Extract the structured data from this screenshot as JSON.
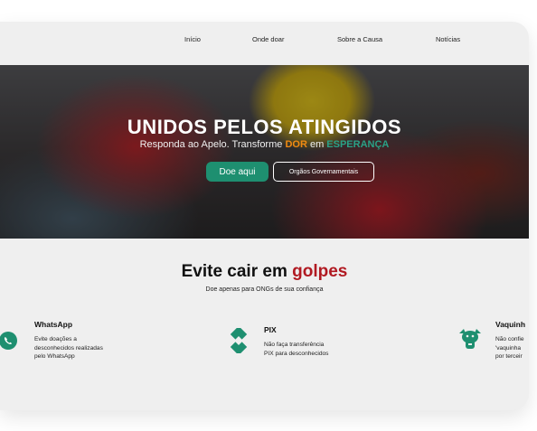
{
  "nav": {
    "items": [
      "Início",
      "Onde doar",
      "Sobre a Causa",
      "Notícias"
    ]
  },
  "hero": {
    "title": "UNIDOS PELOS ATINGIDOS",
    "subtitle_part1": "Responda ao Apelo. Transforme ",
    "subtitle_dor": "DOR",
    "subtitle_part2": " em ",
    "subtitle_esperanca": "ESPERANÇA",
    "primary_button": "Doe aqui",
    "secondary_button": "Orgãos Governamentais"
  },
  "golpes": {
    "title_part1": "Evite cair em ",
    "title_highlight": "golpes",
    "subtitle": "Doe apenas para ONGs de sua confiança",
    "cards": [
      {
        "title": "WhatsApp",
        "desc_lines": [
          "Evite doações a",
          "desconhecidos realizadas",
          "pelo WhatsApp"
        ],
        "icon": "whatsapp-icon"
      },
      {
        "title": "PIX",
        "desc_lines": [
          "Não faça transferência",
          "PIX para desconhecidos"
        ],
        "icon": "pix-icon"
      },
      {
        "title": "Vaquinh",
        "desc_lines": [
          "Não confie",
          "'vaquinha",
          "por terceir"
        ],
        "icon": "piggy-bank-icon"
      }
    ]
  },
  "colors": {
    "brand_green": "#1e8f70",
    "accent_red": "#b11a22",
    "dor_orange": "#f08a12",
    "esperanca_green": "#2aa186"
  }
}
